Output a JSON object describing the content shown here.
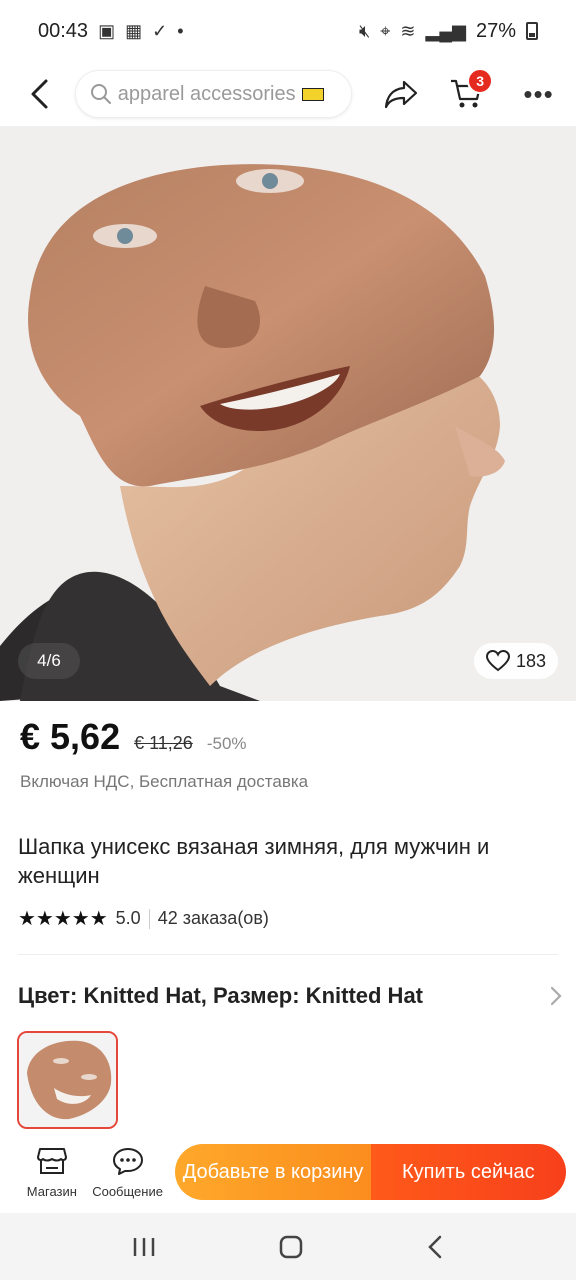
{
  "status_bar": {
    "time": "00:43",
    "battery": "27%"
  },
  "header": {
    "search_placeholder": "apparel accessories",
    "cart_count": "3"
  },
  "gallery": {
    "counter": "4/6",
    "likes": "183"
  },
  "price": {
    "current": "€ 5,62",
    "original": "€ 11,26",
    "discount": "-50%",
    "note": "Включая НДС, Бесплатная доставка"
  },
  "product": {
    "title": "Шапка унисекс вязаная зимняя, для мужчин и женщин",
    "rating": "5.0",
    "orders": "42 заказа(ов)"
  },
  "variant": {
    "label": "Цвет: Knitted Hat, Размер: Knitted Hat"
  },
  "bottom_bar": {
    "store_label": "Магазин",
    "message_label": "Сообщение",
    "add_to_cart": "Добавьте в корзину",
    "buy_now": "Купить сейчас"
  },
  "colors": {
    "accent_orange": "#fb8d1e",
    "accent_red": "#f7401b",
    "badge": "#e52b20"
  }
}
